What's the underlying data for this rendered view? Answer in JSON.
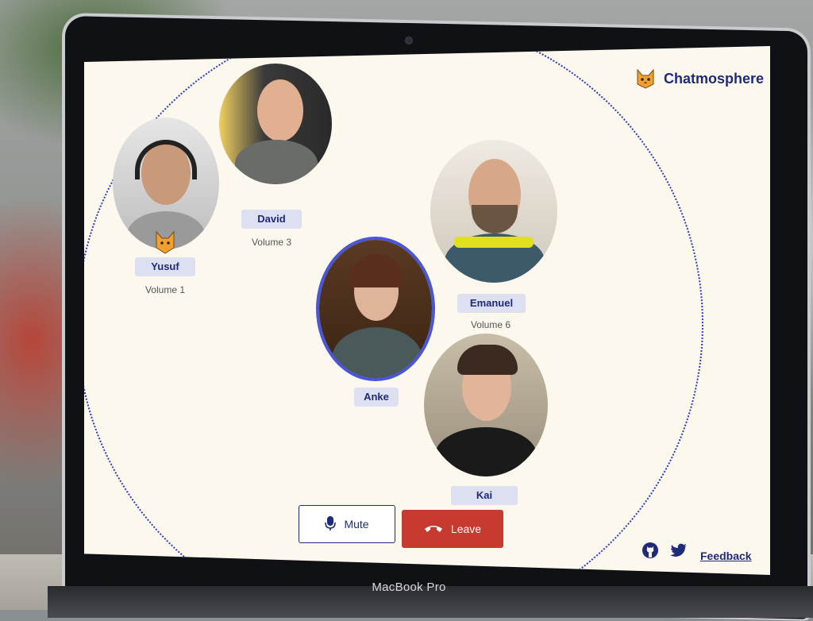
{
  "app": {
    "brand_name": "Chatmosphere",
    "accent": "#1e2a7a",
    "ring_color": "#2e3bc5",
    "screen_bg": "#fdf8ee"
  },
  "hardware": {
    "laptop_label": "MacBook Pro"
  },
  "participants": [
    {
      "name": "Yusuf",
      "volume": "Volume 1",
      "has_cat_badge": true
    },
    {
      "name": "David",
      "volume": "Volume 3"
    },
    {
      "name": "Anke",
      "volume": "",
      "is_self": true
    },
    {
      "name": "Emanuel",
      "volume": "Volume 6"
    },
    {
      "name": "Kai",
      "volume": ""
    }
  ],
  "controls": {
    "mute_label": "Mute",
    "leave_label": "Leave",
    "leave_color": "#c63a30"
  },
  "footer": {
    "feedback_label": "Feedback",
    "icons": [
      "github-icon",
      "twitter-icon"
    ]
  }
}
